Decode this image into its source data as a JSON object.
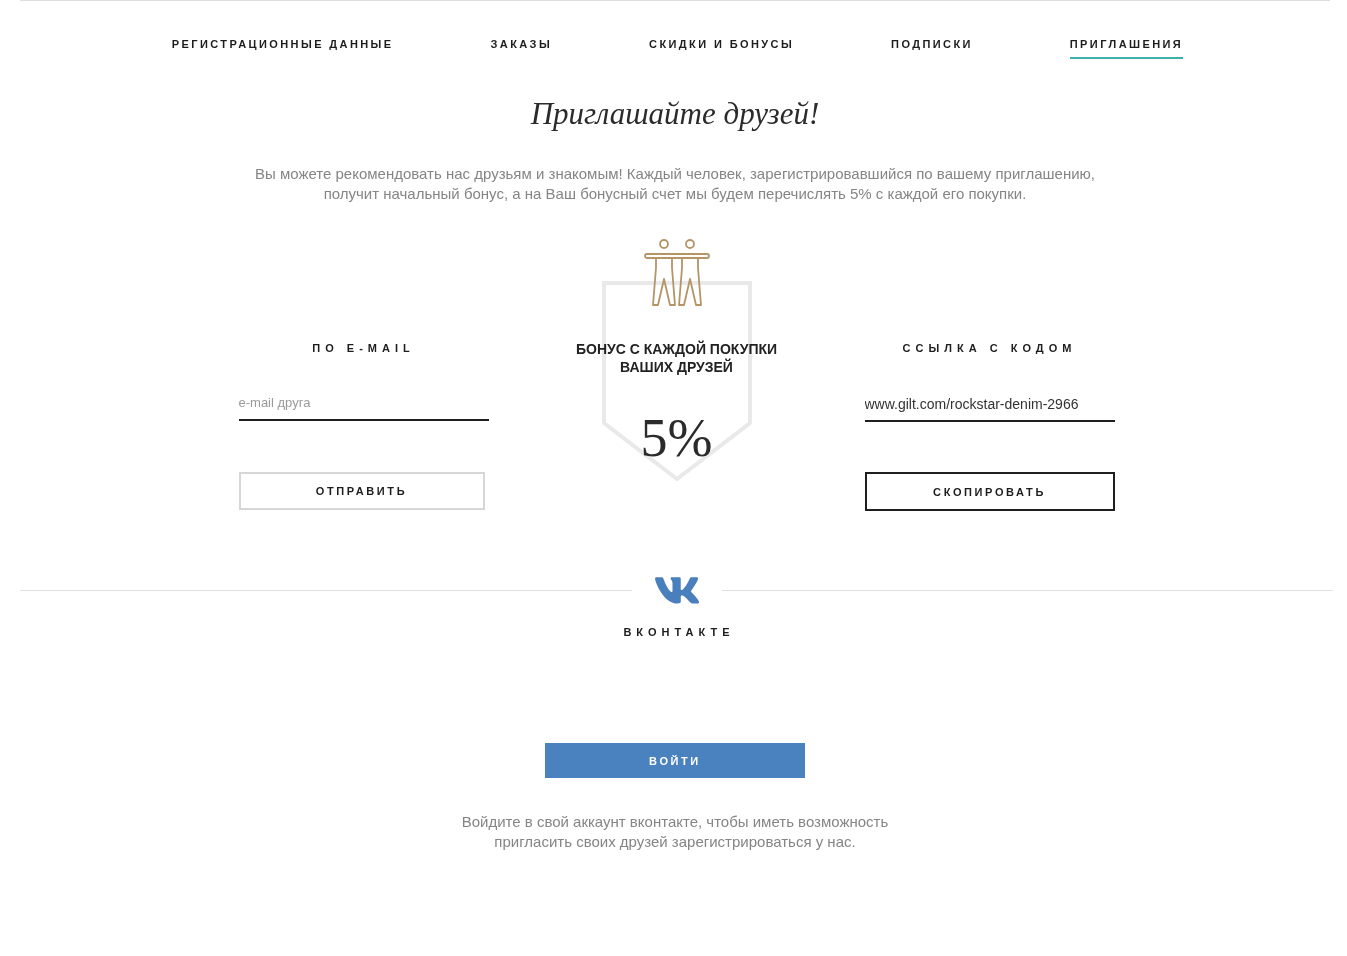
{
  "tabs": [
    {
      "label": "РЕГИСТРАЦИОННЫЕ ДАННЫЕ",
      "selected": false
    },
    {
      "label": "ЗАКАЗЫ",
      "selected": false
    },
    {
      "label": "СКИДКИ И БОНУСЫ",
      "selected": false
    },
    {
      "label": "ПОДПИСКИ",
      "selected": false
    },
    {
      "label": "ПРИГЛАШЕНИЯ",
      "selected": true
    }
  ],
  "title": "Приглашайте друзей!",
  "intro": "Вы можете рекомендовать нас друзьям и знакомым! Каждый человек, зарегистрировавшийся по вашему приглашению, получит начальный бонус, а на Ваш бонусный счет мы будем перечислять 5% с каждой его покупки.",
  "email_invite": {
    "heading": "ПО E-MAIL",
    "field": {
      "placeholder": "e-mail друга"
    },
    "button": {
      "label": "ОТПРАВИТЬ",
      "disabled": true
    }
  },
  "bonus": {
    "heading": "БОНУС С КАЖДОЙ ПОКУПКИ ВАШИХ ДРУЗЕЙ",
    "value": "5%"
  },
  "link_invite": {
    "heading": "ССЫЛКА С КОДОМ",
    "field": {
      "value": "www.gilt.com/rockstar-denim-2966"
    },
    "button": {
      "label": "СКОПИРОВАТЬ",
      "disabled": false
    }
  },
  "vk": {
    "title": "ВКОНТАКТЕ",
    "button": "ВОЙТИ",
    "note": "Войдите в свой аккаунт вконтакте, чтобы иметь возможность пригласить своих друзей зарегистрироваться у нас."
  }
}
